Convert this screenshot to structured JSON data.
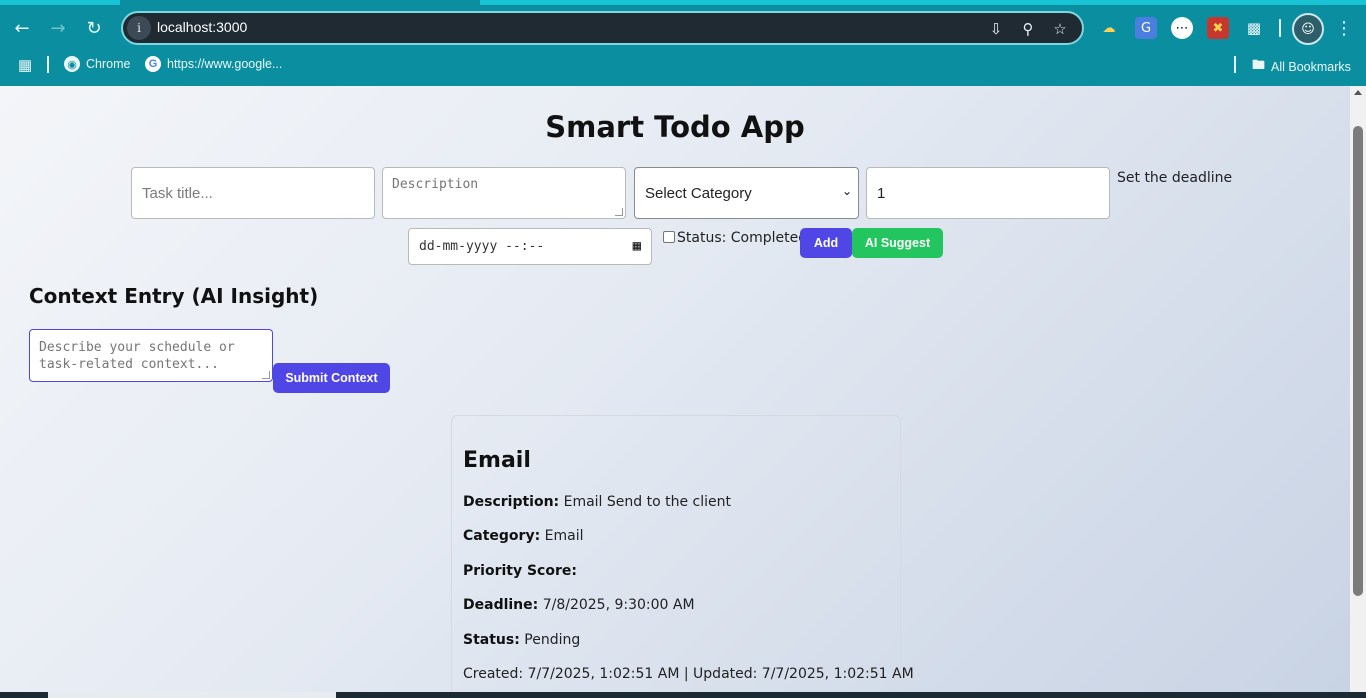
{
  "browser": {
    "url": "localhost:3000",
    "bookmarks": [
      {
        "label": "Chrome",
        "icon": "chrome-icon"
      },
      {
        "label": "https://www.google...",
        "icon": "google-icon"
      }
    ],
    "all_bookmarks_label": "All Bookmarks"
  },
  "app": {
    "title": "Smart Todo App",
    "form": {
      "task_title_placeholder": "Task title...",
      "description_placeholder": "Description",
      "category_value": "Select Category",
      "priority_value": "1",
      "deadline_label": "Set the deadline",
      "deadline_placeholder": "dd-mm-yyyy --:--",
      "status_label": "Status: Completed",
      "add_label": "Add",
      "ai_suggest_label": "AI Suggest"
    },
    "context": {
      "heading": "Context Entry (AI Insight)",
      "placeholder": "Describe your schedule or task-related context...",
      "submit_label": "Submit Context"
    },
    "task": {
      "title": "Email",
      "description_label": "Description:",
      "description": "Email Send to the client",
      "category_label": "Category:",
      "category": "Email",
      "priority_label": "Priority Score:",
      "priority": "",
      "deadline_label": "Deadline:",
      "deadline": "7/8/2025, 9:30:00 AM",
      "status_label": "Status:",
      "status": "Pending",
      "timestamps": "Created: 7/7/2025, 1:02:51 AM | Updated: 7/7/2025, 1:02:51 AM"
    }
  },
  "colors": {
    "chrome": "#0b8fa0",
    "primary_button": "#4f46e5",
    "suggest_button": "#22c55e"
  }
}
